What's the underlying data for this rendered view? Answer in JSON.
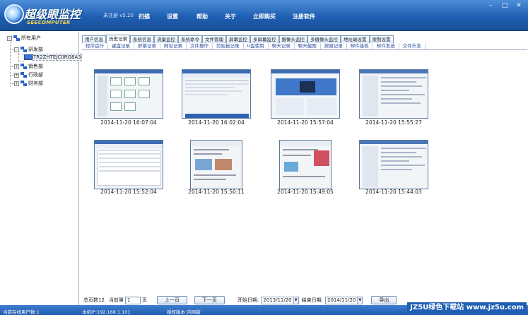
{
  "app": {
    "logo_text": "超级眼监控",
    "logo_sub": "SEECOMPUTER",
    "version": "未注册 v5.20",
    "menu": [
      "扫描",
      "设置",
      "帮助",
      "关于",
      "立即购买",
      "注册软件"
    ],
    "window_buttons": [
      "–",
      "□",
      "✕"
    ]
  },
  "tree": {
    "root": "所有用户",
    "nodes": [
      "研发部",
      "TR2ZHTEJC0RG8A3",
      "销售部",
      "行政部",
      "财务部"
    ],
    "expander_plus": "+",
    "expander_minus": "-"
  },
  "tabs": [
    "用户信息",
    "历史记录",
    "系统信息",
    "流量监控",
    "系统命令",
    "文件管理",
    "屏幕监控",
    "多屏幕监控",
    "摄像头监控",
    "多摄像头监控",
    "地址端设置",
    "限制设置"
  ],
  "active_tab": 1,
  "subtabs": [
    "程序运行",
    "键盘记录",
    "屏幕记录",
    "网址记录",
    "文件操作",
    "剪贴板记录",
    "U盘使用",
    "聊天记录",
    "聊天截图",
    "按窗记录",
    "邮件接收",
    "邮件发送",
    "文件外发"
  ],
  "screenshots": [
    {
      "time": "2014-11-20 16:07:04"
    },
    {
      "time": "2014-11-20 16:02:04"
    },
    {
      "time": "2014-11-20 15:57:04"
    },
    {
      "time": "2014-11-20 15:55:27"
    },
    {
      "time": "2014-11-20 15:52:04"
    },
    {
      "time": "2014-11-20 15:50:11"
    },
    {
      "time": "2014-11-20 15:49:05"
    },
    {
      "time": "2014-11-20 15:44:03"
    }
  ],
  "footer": {
    "total_label": "总页数12",
    "current_label": "当前第",
    "current_value": "1",
    "page_suffix": "页",
    "prev_label": "上一页",
    "next_label": "下一页",
    "start_label": "开始日期:",
    "start_value": "2013/11/20",
    "end_label": "结束日期:",
    "end_value": "2014/11/20",
    "export_label": "导出",
    "dropdown_glyph": "▼"
  },
  "status": {
    "online": "当前在线用户数:1",
    "ip": "本机IP:192.168.1.101",
    "edition": "授权版本:内网版"
  },
  "watermark": "JZ5U绿色下载站 www.jz5u.com",
  "colors": {
    "titlebar": "#1f5fb3",
    "accent": "#2a4fa0"
  }
}
